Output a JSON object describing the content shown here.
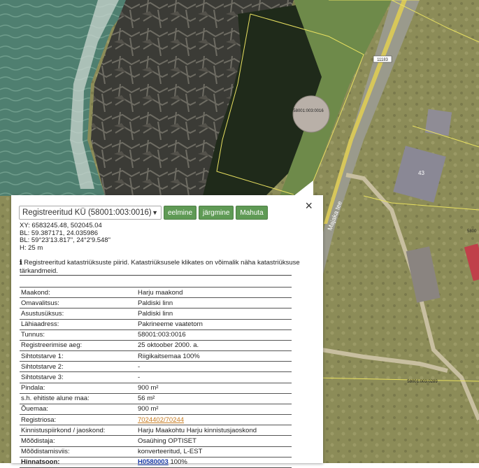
{
  "map": {
    "road_label": "Majaka tee",
    "road_number": "11183",
    "house_number": "43",
    "parcel_labels": [
      "58001:003:0016",
      "58001:003:0289",
      "5800"
    ]
  },
  "popup": {
    "close_label": "×",
    "select_value": "Registreeritud KÜ (58001:003:0016)",
    "buttons": {
      "prev": "eelmine",
      "next": "järgmine",
      "fit": "Mahuta"
    },
    "coords": [
      "XY: 6583245.48, 502045.04",
      "BL: 59.387171, 24.035986",
      "BL: 59°23'13.817\", 24°2'9.548\"",
      "H: 25 m"
    ],
    "info_icon": "ℹ",
    "info_text": "Registreeritud katastriüksuste piirid. Katastriüksusele klikates on võimalik näha katastriüksuse tärkandmeid.",
    "rows": [
      {
        "key": "Maakond:",
        "value": "Harju maakond"
      },
      {
        "key": "Omavalitsus:",
        "value": "Paldiski linn"
      },
      {
        "key": "Asustusüksus:",
        "value": "Paldiski linn"
      },
      {
        "key": "Lähiaadress:",
        "value": "Pakrineeme vaatetorn"
      },
      {
        "key": "Tunnus:",
        "value": "58001:003:0016"
      },
      {
        "key": "Registreerimise aeg:",
        "value": "25 oktoober 2000. a."
      },
      {
        "key": "Sihtotstarve 1:",
        "value": "Riigikaitsemaa 100%"
      },
      {
        "key": "Sihtotstarve 2:",
        "value": "-"
      },
      {
        "key": "Sihtotstarve 3:",
        "value": "-"
      },
      {
        "key": "Pindala:",
        "value": "900 m²"
      },
      {
        "key": "s.h. ehitiste alune maa:",
        "value": "56 m²"
      },
      {
        "key": "Õuemaa:",
        "value": "900 m²"
      },
      {
        "key": "Registriosa:",
        "value": "7024402/70244"
      },
      {
        "key": "Kinnistuspiirkond / jaoskond:",
        "value": "Harju Maakohtu Harju kinnistusjaoskond"
      },
      {
        "key": "Mõõdistaja:",
        "value": "Osaühing OPTISET"
      },
      {
        "key": "Mõõdistamisviis:",
        "value": "konverteeritud, L-EST"
      },
      {
        "key": "Hinnatsoon:",
        "value": "H0580003",
        "suffix": "100%"
      }
    ]
  }
}
